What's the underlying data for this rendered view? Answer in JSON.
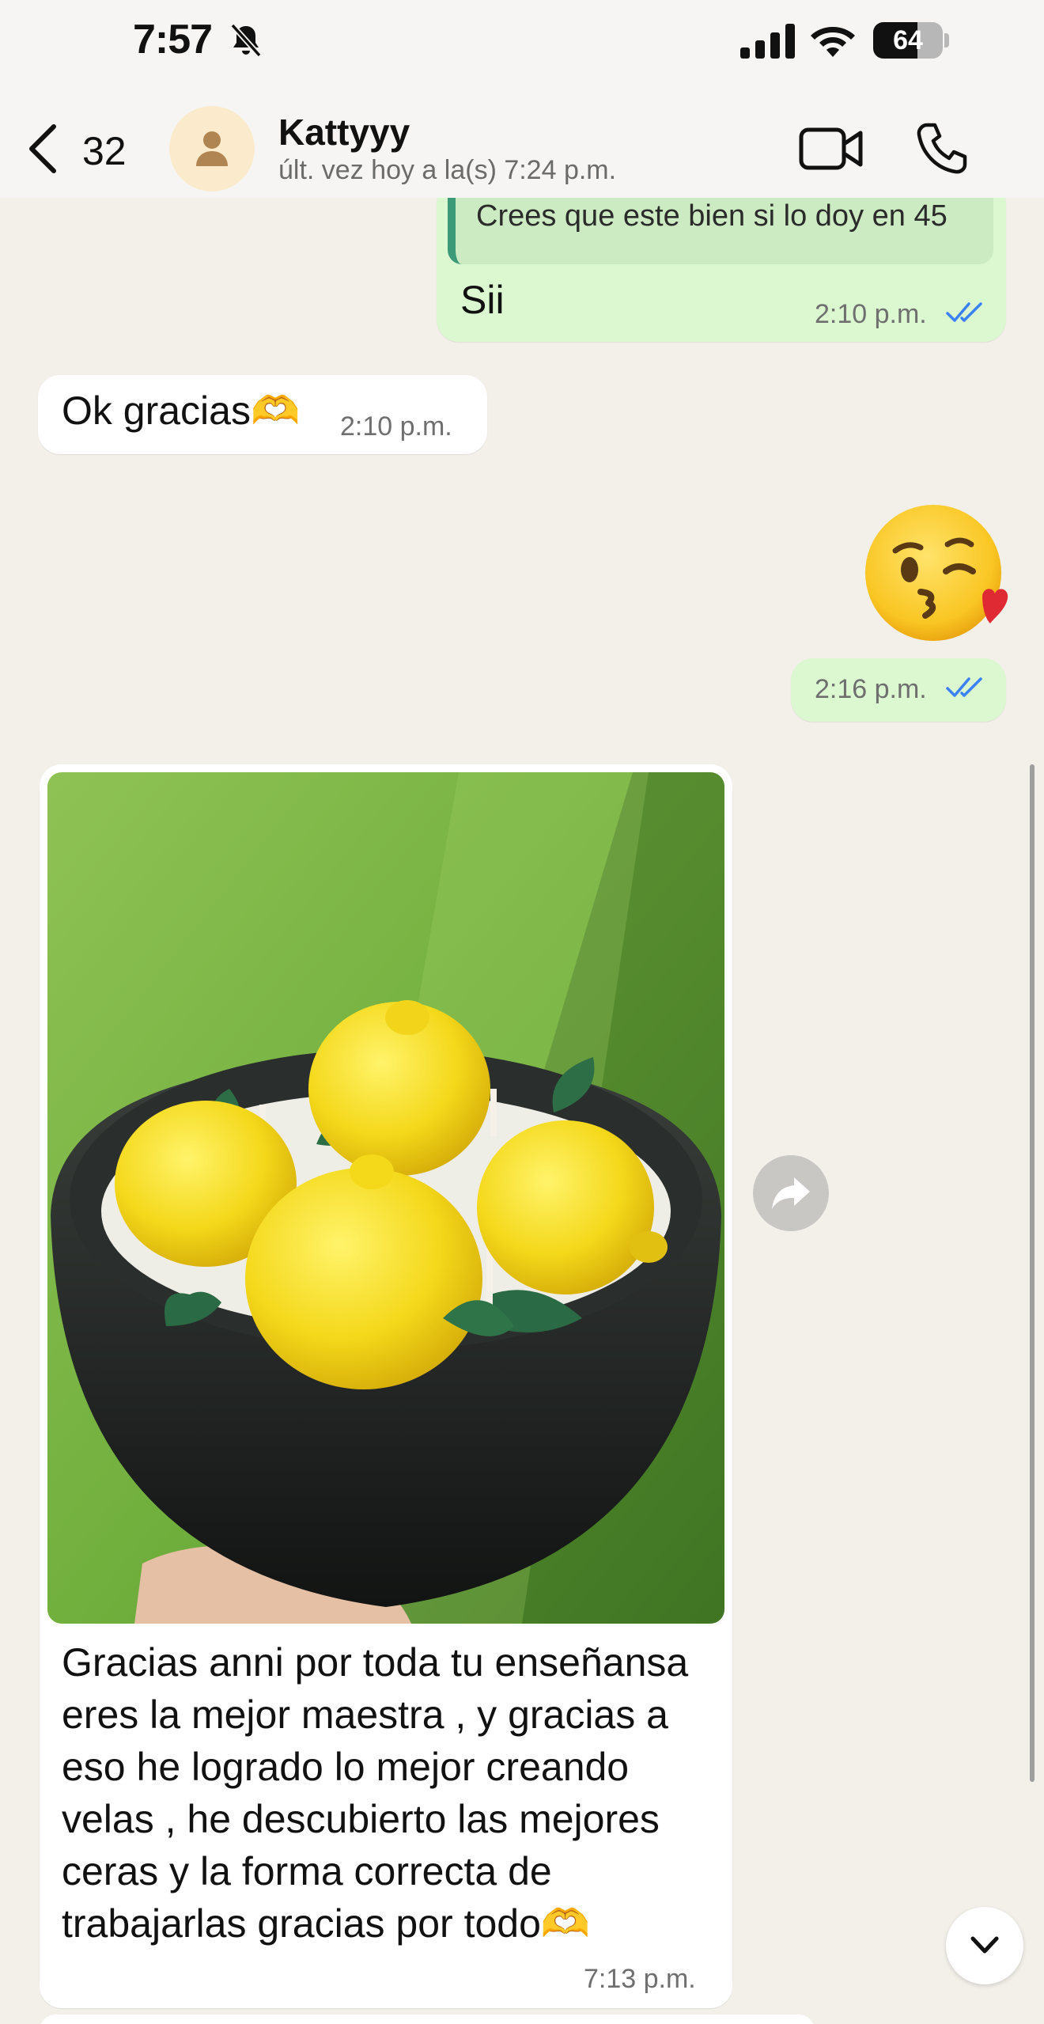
{
  "status_bar": {
    "time": "7:57",
    "battery": "64",
    "battery_level_percent": 64,
    "icons": [
      "bell-slash-icon",
      "signal-icon",
      "wifi-icon",
      "battery-icon"
    ]
  },
  "header": {
    "back_count": "32",
    "contact_name": "Kattyyy",
    "last_seen": "últ. vez hoy a la(s) 7:24 p.m.",
    "icons": [
      "back-chevron-icon",
      "person-icon",
      "video-camera-icon",
      "phone-icon"
    ]
  },
  "messages": [
    {
      "direction": "outgoing",
      "quoted_text": "Crees que este bien si lo doy en 45",
      "text": "Sii",
      "time": "2:10 p.m.",
      "read": true
    },
    {
      "direction": "incoming",
      "text": "Ok gracias🫶",
      "time": "2:10 p.m."
    },
    {
      "direction": "outgoing",
      "emoji": "face-blowing-a-kiss",
      "time": "2:16 p.m.",
      "read": true
    },
    {
      "direction": "incoming",
      "image": "black bowl candle with wax lemons held outdoors on grass",
      "text": "Gracias anni por toda tu enseñansa eres la mejor maestra , y gracias a eso he logrado lo mejor creando velas , he descubierto las mejores ceras y la forma correcta de trabajarlas gracias por todo🫶",
      "time": "7:13 p.m."
    }
  ],
  "colors": {
    "background": "#f3f0ea",
    "outgoing_bubble": "#dcf8d1",
    "incoming_bubble": "#ffffff",
    "read_ticks": "#3b82f6",
    "quote_bar": "#3c9a78"
  }
}
